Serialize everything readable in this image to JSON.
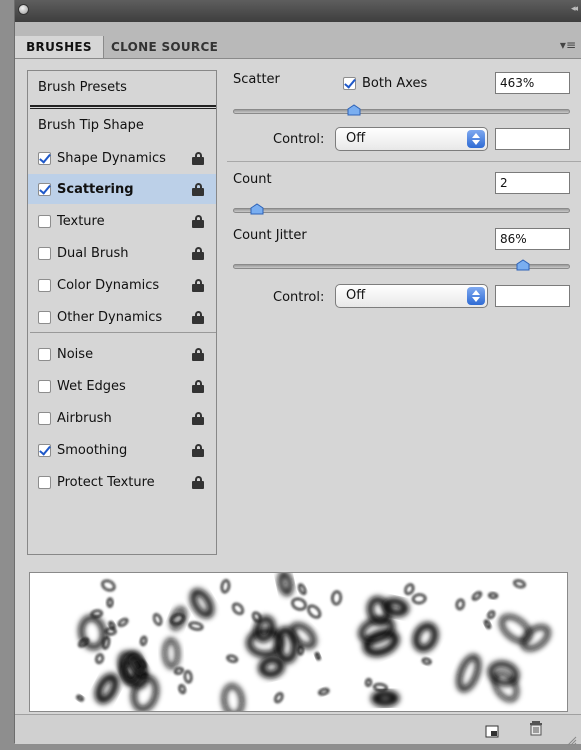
{
  "tabs": {
    "brushes": "BRUSHES",
    "clone_source": "CLONE SOURCE"
  },
  "sidebar": {
    "brush_presets": "Brush Presets",
    "brush_tip_shape": "Brush Tip Shape",
    "items": [
      {
        "label": "Shape Dynamics",
        "checked": true,
        "selected": false
      },
      {
        "label": "Scattering",
        "checked": true,
        "selected": true
      },
      {
        "label": "Texture",
        "checked": false,
        "selected": false
      },
      {
        "label": "Dual Brush",
        "checked": false,
        "selected": false
      },
      {
        "label": "Color Dynamics",
        "checked": false,
        "selected": false
      },
      {
        "label": "Other Dynamics",
        "checked": false,
        "selected": false
      },
      {
        "label": "Noise",
        "checked": false,
        "selected": false
      },
      {
        "label": "Wet Edges",
        "checked": false,
        "selected": false
      },
      {
        "label": "Airbrush",
        "checked": false,
        "selected": false
      },
      {
        "label": "Smoothing",
        "checked": true,
        "selected": false
      },
      {
        "label": "Protect Texture",
        "checked": false,
        "selected": false
      }
    ]
  },
  "scatter": {
    "label": "Scatter",
    "both_axes_label": "Both Axes",
    "both_axes_checked": true,
    "value": "463%",
    "slider_fraction": 0.36
  },
  "control1": {
    "label": "Control:",
    "value": "Off"
  },
  "count": {
    "label": "Count",
    "value": "2",
    "slider_fraction": 0.07
  },
  "count_jitter": {
    "label": "Count Jitter",
    "value": "86%",
    "slider_fraction": 0.86
  },
  "control2": {
    "label": "Control:",
    "value": "Off"
  },
  "icons": {
    "menu": "panel-menu-icon",
    "new": "new-brush-icon",
    "trash": "delete-icon",
    "lock": "lock-icon",
    "resize": "resize-grip-icon"
  }
}
